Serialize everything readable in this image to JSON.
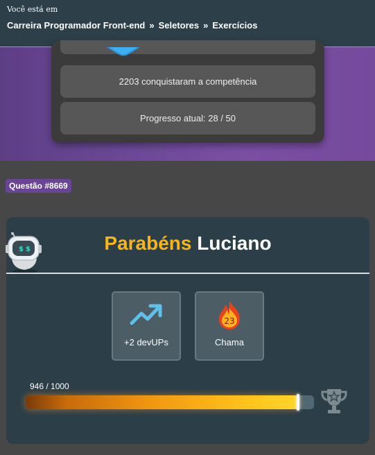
{
  "header": {
    "you_are_in": "Você está em",
    "breadcrumbs": [
      "Carreira Programador Front-end",
      "Seletores",
      "Exercícios"
    ],
    "separator": "»"
  },
  "hero_card": {
    "achievers": "2203 conquistaram a competência",
    "progress": "Progresso atual: 28 / 50"
  },
  "question_tag": "Questão #8669",
  "result": {
    "congrats_word": "Parabéns",
    "user_name": "Luciano",
    "rewards": [
      {
        "label": "+2 devUPs",
        "icon": "trending-up-icon"
      },
      {
        "label": "Chama",
        "icon": "flame-icon",
        "count": "23"
      }
    ],
    "progress_text": "946 / 1000",
    "progress_fraction": 0.946
  },
  "colors": {
    "accent_purple": "#6a4595",
    "gold": "#f5b51b",
    "panel": "#2c3e48"
  }
}
